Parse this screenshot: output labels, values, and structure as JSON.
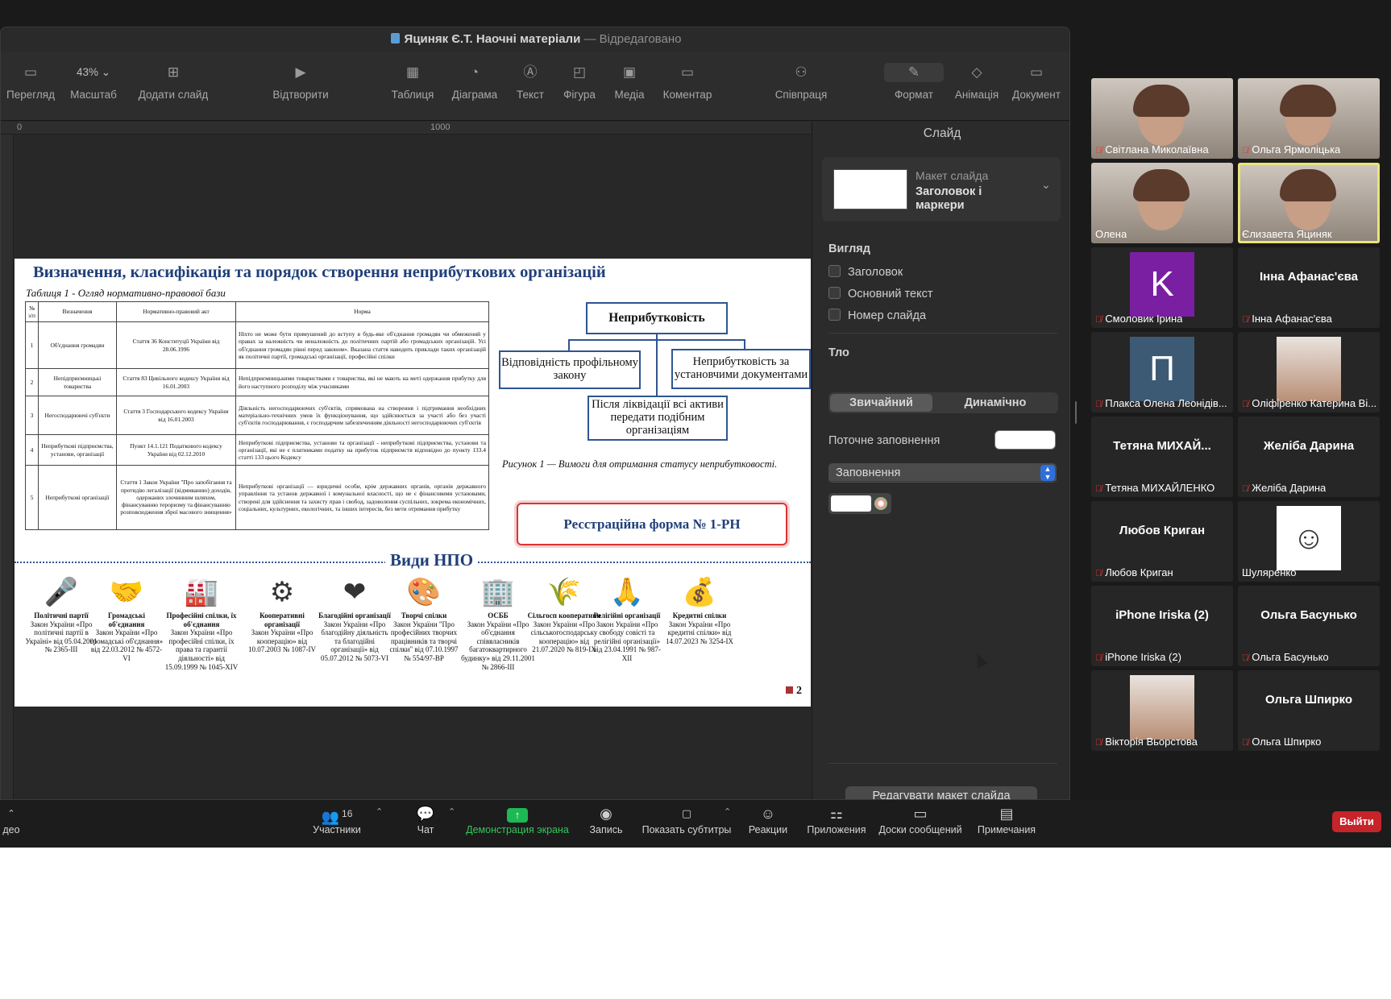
{
  "keynote": {
    "title": "Яциняк Є.Т. Наочні матеріали",
    "separator": "—",
    "edited": "Відредаговано",
    "toolbar": {
      "view": "Перегляд",
      "zoom_value": "43%",
      "zoom": "Масштаб",
      "add_slide": "Додати слайд",
      "play": "Відтворити",
      "table": "Таблиця",
      "chart": "Діаграма",
      "text": "Текст",
      "shape": "Фігура",
      "media": "Медіа",
      "comment": "Коментар",
      "collaborate": "Співпраця",
      "format": "Формат",
      "animate": "Анімація",
      "document": "Документ"
    },
    "ruler": {
      "mark0": "0",
      "mark1000": "1000"
    },
    "inspector": {
      "title": "Слайд",
      "layout_label": "Макет слайда",
      "layout_value": "Заголовок і маркери",
      "appearance": "Вигляд",
      "chk_title": "Заголовок",
      "chk_body": "Основний текст",
      "chk_number": "Номер слайда",
      "background": "Тло",
      "seg_standard": "Звичайний",
      "seg_dynamic": "Динамічно",
      "current_fill": "Поточне заповнення",
      "fill_type": "Заповнення",
      "edit_layout": "Редагувати макет слайда"
    }
  },
  "slide": {
    "title": "Визначення, класифікація та порядок створення неприбуткових організацій",
    "table_caption": "Таблиця 1 - Огляд нормативно-правової бази",
    "table_headers": [
      "№ з/п",
      "Визначення",
      "Нормативно-правовий акт",
      "Норма"
    ],
    "table_rows": [
      [
        "1",
        "Об'єднання громадян",
        "Стаття 36 Конституції України від 28.06.1996",
        "Ніхто не може бути примушений до вступу в будь-яке об'єднання громадян чи обмежений у правах за належність чи неналежність до політичних партій або громадських організацій. Усі об'єднання громадян рівні перед законом». Вказана стаття наводить приклади таких організацій як політичні партії, громадські організації, професійні спілки"
      ],
      [
        "2",
        "Непідприємницькі товариства",
        "Стаття 83 Цивільного кодексу України від 16.01.2003",
        "Непідприємницькими товариствами є товариства, які не мають на меті одержання прибутку для його наступного розподілу між учасниками"
      ],
      [
        "3",
        "Негосподарюючі суб'єкти",
        "Стаття 3 Господарського кодексу України від 16.01.2003",
        "Діяльність негосподарюючих суб'єктів, спрямована на створення і підтримання необхідних матеріально-технічних умов їх функціонування, що здійснюється за участі або без участі суб'єктів господарювання, є господарчим забезпеченням діяльності негосподарюючих суб'єктів"
      ],
      [
        "4",
        "Неприбуткові підприємства, установи, організації",
        "Пункт 14.1.121 Податкового кодексу України від 02.12.2010",
        "Неприбуткові підприємства, установи та організації - неприбуткові підприємства, установи та організації, які не є платниками податку на прибуток підприємств відповідно до пункту 133.4 статті 133 цього Кодексу"
      ],
      [
        "5",
        "Неприбуткові організації",
        "Стаття 1 Закон України \"Про запобігання та протидію легалізації (відмиванню) доходів, одержаних злочинним шляхом, фінансуванню тероризму та фінансуванню розповсюдження зброї масового знищення»",
        "Неприбуткові організації — юридичні особи, крім державних органів, органів державного управління та установ державної і комунальної власності, що не є фінансовими установами, створені для здійснення та захисту прав і свобод, задоволення суспільних, зокрема економічних, соціальних, культурних, екологічних, та інших інтересів, без мети отримання прибутку"
      ]
    ],
    "org_top": "Неприбутковість",
    "org_left": "Відповідність профільному закону",
    "org_right": "Неприбутковість за установчими документами",
    "org_bottom": "Після ліквідації всі активи передати подібним організаціям",
    "fig_caption": "Рисунок 1 — Вимоги для отримання статусу неприбутковості.",
    "reg_form": "Ресстраційна форма № 1-РН",
    "types_title": "Види НПО",
    "types": [
      {
        "name": "Політичні партії",
        "law": "Закон України «Про політичні партії в Україні» від 05.04.2001 № 2365-III",
        "icon": "podium-icon",
        "glyph": "🎤"
      },
      {
        "name": "Громадські об'єднання",
        "law": "Закон України «Про громадські об'єднання» від 22.03.2012 № 4572-VI",
        "icon": "handshake-icon",
        "glyph": "🤝"
      },
      {
        "name": "Професійні спілки, їх об'єднання",
        "law": "Закон України «Про професійні спілки, їх права та гарантії діяльності» від 15.09.1999 № 1045-XIV",
        "icon": "factory-icon",
        "glyph": "🏭"
      },
      {
        "name": "Кооперативні організації",
        "law": "Закон України «Про кооперацію» від 10.07.2003 № 1087-IV",
        "icon": "cooperation-icon",
        "glyph": "⚙"
      },
      {
        "name": "Благодійні організації",
        "law": "Закон України «Про благодійну діяльність та благодійні організації» від 05.07.2012 № 5073-VI",
        "icon": "charity-icon",
        "glyph": "❤"
      },
      {
        "name": "Творчі спілки",
        "law": "Закон України \"Про професійних творчих працівників та творчі спілки\" від 07.10.1997 № 554/97-ВР",
        "icon": "artist-icon",
        "glyph": "🎨"
      },
      {
        "name": "ОСББ",
        "law": "Закон України «Про об'єднання співвласників багатоквартирного будинку» від 29.11.2001 № 2866-III",
        "icon": "building-icon",
        "glyph": "🏢"
      },
      {
        "name": "Сільгосп кооперативи",
        "law": "Закон України «Про сільськогосподарську кооперацію» від 21.07.2020 № 819-IX",
        "icon": "farmers-icon",
        "glyph": "🌾"
      },
      {
        "name": "Релігійні організації",
        "law": "Закон України «Про свободу совісті та релігійні організації» від 23.04.1991 № 987-XII",
        "icon": "praying-hands-icon",
        "glyph": "🙏"
      },
      {
        "name": "Кредитні спілки",
        "law": "Закон України «Про кредитні спілки» від 14.07.2023 № 3254-IX",
        "icon": "money-hands-icon",
        "glyph": "💰"
      }
    ],
    "page_number": "2"
  },
  "zoom_bar": {
    "video_partial": "део",
    "participants_count": "16",
    "participants": "Участники",
    "chat": "Чат",
    "share": "Демонстрация экрана",
    "record": "Запись",
    "captions": "Показать субтитры",
    "reactions": "Реакции",
    "apps": "Приложения",
    "whiteboards": "Доски сообщений",
    "notes": "Примечания",
    "leave": "Выйти"
  },
  "gallery": [
    {
      "name": "Світлана Миколаївна",
      "type": "photo",
      "muted": true
    },
    {
      "name": "Ольга Ярмоліцька",
      "type": "photo",
      "muted": true
    },
    {
      "name": "Олена",
      "type": "photo",
      "muted": false
    },
    {
      "name": "Єлизавета Яциняк",
      "type": "photo",
      "muted": false,
      "active": true
    },
    {
      "name": "Смоловик Ірина",
      "type": "avatar",
      "letter": "K",
      "color": "#7a1fa2",
      "muted": true
    },
    {
      "name": "Інна Афанас'єва",
      "type": "text",
      "big": "Інна Афанас'єва",
      "muted": true
    },
    {
      "name": "Плакса Олена Леонідів...",
      "type": "avatar",
      "letter": "П",
      "color": "#3d5a75",
      "muted": true
    },
    {
      "name": "Оліфіренко Катерина Ві...",
      "type": "photo-small",
      "muted": true
    },
    {
      "name": "Тетяна МИХАЙЛЕНКО",
      "type": "text",
      "big": "Тетяна МИХАЙ...",
      "muted": true
    },
    {
      "name": "Желіба Дарина",
      "type": "text",
      "big": "Желіба Дарина",
      "muted": true
    },
    {
      "name": "Любов Криган",
      "type": "text",
      "big": "Любов Криган",
      "muted": true
    },
    {
      "name": "Шуляренко",
      "type": "cartoon",
      "muted": false
    },
    {
      "name": "iPhone Iriska (2)",
      "type": "text",
      "big": "iPhone Iriska (2)",
      "muted": true
    },
    {
      "name": "Ольга Басунько",
      "type": "text",
      "big": "Ольга Басунько",
      "muted": true
    },
    {
      "name": "Вікторія Вьорстова",
      "type": "photo-small",
      "muted": true
    },
    {
      "name": "Ольга Шпирко",
      "type": "text",
      "big": "Ольга Шпирко",
      "muted": true
    }
  ]
}
